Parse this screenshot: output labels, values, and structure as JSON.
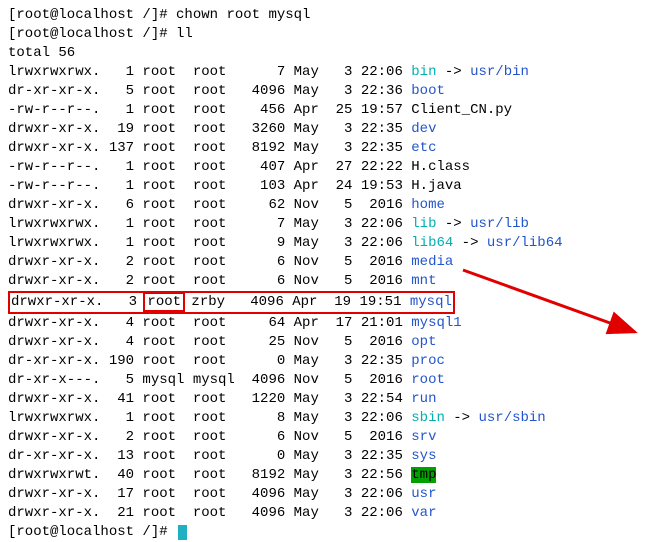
{
  "prompt1_user": "root",
  "prompt1_host": "localhost",
  "prompt1_path": "/",
  "cmd1": "chown root mysql",
  "cmd2": "ll",
  "total_label": "total 56",
  "cursor": "_",
  "rows": [
    {
      "perm": "lrwxrwxrwx.",
      "links": "  1",
      "owner": "root",
      "group": "root",
      "size": "    7",
      "date": "May   3 22:06",
      "name": "bin",
      "nameClass": "linkcyan",
      "arrow": " -> ",
      "arrowClass": "blk",
      "target": "usr/bin",
      "targetClass": "dirblue"
    },
    {
      "perm": "dr-xr-xr-x.",
      "links": "  5",
      "owner": "root",
      "group": "root",
      "size": " 4096",
      "date": "May   3 22:36",
      "name": "boot",
      "nameClass": "dirblue"
    },
    {
      "perm": "-rw-r--r--.",
      "links": "  1",
      "owner": "root",
      "group": "root",
      "size": "  456",
      "date": "Apr  25 19:57",
      "name": "Client_CN.py",
      "nameClass": "blk"
    },
    {
      "perm": "drwxr-xr-x.",
      "links": " 19",
      "owner": "root",
      "group": "root",
      "size": " 3260",
      "date": "May   3 22:35",
      "name": "dev",
      "nameClass": "dirblue"
    },
    {
      "perm": "drwxr-xr-x.",
      "links": "137",
      "owner": "root",
      "group": "root",
      "size": " 8192",
      "date": "May   3 22:35",
      "name": "etc",
      "nameClass": "dirblue"
    },
    {
      "perm": "-rw-r--r--.",
      "links": "  1",
      "owner": "root",
      "group": "root",
      "size": "  407",
      "date": "Apr  27 22:22",
      "name": "H.class",
      "nameClass": "blk"
    },
    {
      "perm": "-rw-r--r--.",
      "links": "  1",
      "owner": "root",
      "group": "root",
      "size": "  103",
      "date": "Apr  24 19:53",
      "name": "H.java",
      "nameClass": "blk"
    },
    {
      "perm": "drwxr-xr-x.",
      "links": "  6",
      "owner": "root",
      "group": "root",
      "size": "   62",
      "date": "Nov   5  2016",
      "name": "home",
      "nameClass": "dirblue"
    },
    {
      "perm": "lrwxrwxrwx.",
      "links": "  1",
      "owner": "root",
      "group": "root",
      "size": "    7",
      "date": "May   3 22:06",
      "name": "lib",
      "nameClass": "linkcyan",
      "arrow": " -> ",
      "arrowClass": "blk",
      "target": "usr/lib",
      "targetClass": "dirblue"
    },
    {
      "perm": "lrwxrwxrwx.",
      "links": "  1",
      "owner": "root",
      "group": "root",
      "size": "    9",
      "date": "May   3 22:06",
      "name": "lib64",
      "nameClass": "linkcyan",
      "arrow": " -> ",
      "arrowClass": "blk",
      "target": "usr/lib64",
      "targetClass": "dirblue"
    },
    {
      "perm": "drwxr-xr-x.",
      "links": "  2",
      "owner": "root",
      "group": "root",
      "size": "    6",
      "date": "Nov   5  2016",
      "name": "media",
      "nameClass": "dirblue"
    },
    {
      "perm": "drwxr-xr-x.",
      "links": "  2",
      "owner": "root",
      "group": "root",
      "size": "    6",
      "date": "Nov   5  2016",
      "name": "mnt",
      "nameClass": "dirblue"
    },
    {
      "perm": "drwxr-xr-x.",
      "links": "  3",
      "owner": "root",
      "ownerBox": true,
      "group": "zrby",
      "size": " 4096",
      "date": "Apr  19 19:51",
      "name": "mysql",
      "nameClass": "dirblue",
      "outerBox": true
    },
    {
      "perm": "drwxr-xr-x.",
      "links": "  4",
      "owner": "root",
      "group": "root",
      "size": "   64",
      "date": "Apr  17 21:01",
      "name": "mysql1",
      "nameClass": "dirblue"
    },
    {
      "perm": "drwxr-xr-x.",
      "links": "  4",
      "owner": "root",
      "group": "root",
      "size": "   25",
      "date": "Nov   5  2016",
      "name": "opt",
      "nameClass": "dirblue"
    },
    {
      "perm": "dr-xr-xr-x.",
      "links": "190",
      "owner": "root",
      "group": "root",
      "size": "    0",
      "date": "May   3 22:35",
      "name": "proc",
      "nameClass": "dirblue"
    },
    {
      "perm": "dr-xr-x---.",
      "links": "  5",
      "owner": "mysql",
      "group": "mysql",
      "size": " 4096",
      "date": "Nov   5  2016",
      "name": "root",
      "nameClass": "dirblue"
    },
    {
      "perm": "drwxr-xr-x.",
      "links": " 41",
      "owner": "root",
      "group": "root",
      "size": " 1220",
      "date": "May   3 22:54",
      "name": "run",
      "nameClass": "dirblue"
    },
    {
      "perm": "lrwxrwxrwx.",
      "links": "  1",
      "owner": "root",
      "group": "root",
      "size": "    8",
      "date": "May   3 22:06",
      "name": "sbin",
      "nameClass": "linkcyan",
      "arrow": " -> ",
      "arrowClass": "blk",
      "target": "usr/sbin",
      "targetClass": "dirblue"
    },
    {
      "perm": "drwxr-xr-x.",
      "links": "  2",
      "owner": "root",
      "group": "root",
      "size": "    6",
      "date": "Nov   5  2016",
      "name": "srv",
      "nameClass": "dirblue"
    },
    {
      "perm": "dr-xr-xr-x.",
      "links": " 13",
      "owner": "root",
      "group": "root",
      "size": "    0",
      "date": "May   3 22:35",
      "name": "sys",
      "nameClass": "dirblue"
    },
    {
      "perm": "drwxrwxrwt.",
      "links": " 40",
      "owner": "root",
      "group": "root",
      "size": " 8192",
      "date": "May   3 22:56",
      "name": "tmp",
      "nameClass": "hi"
    },
    {
      "perm": "drwxr-xr-x.",
      "links": " 17",
      "owner": "root",
      "group": "root",
      "size": " 4096",
      "date": "May   3 22:06",
      "name": "usr",
      "nameClass": "dirblue"
    },
    {
      "perm": "drwxr-xr-x.",
      "links": " 21",
      "owner": "root",
      "group": "root",
      "size": " 4096",
      "date": "May   3 22:06",
      "name": "var",
      "nameClass": "dirblue"
    }
  ]
}
